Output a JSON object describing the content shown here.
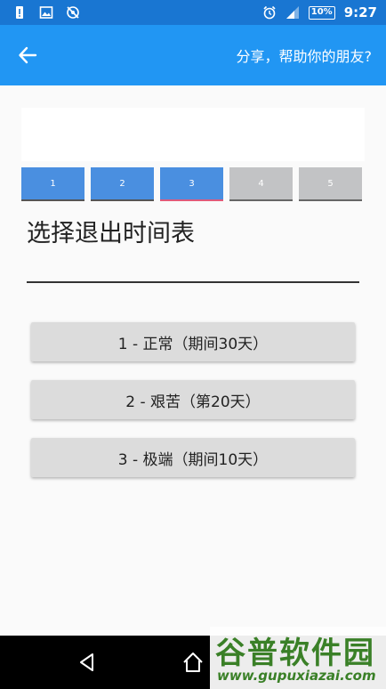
{
  "status_bar": {
    "time": "9:27",
    "battery": "10%",
    "left_icons": [
      "battery-alert-icon",
      "image-icon",
      "sync-disabled-icon"
    ],
    "right_icons": [
      "alarm-icon",
      "signal-icon",
      "battery-icon"
    ]
  },
  "app_bar": {
    "back_icon": "arrow-left-icon",
    "share_label": "分享，帮助你的朋友?"
  },
  "steps": [
    {
      "label": "1",
      "state": "done"
    },
    {
      "label": "2",
      "state": "done"
    },
    {
      "label": "3",
      "state": "current"
    },
    {
      "label": "4",
      "state": "todo"
    },
    {
      "label": "5",
      "state": "todo"
    }
  ],
  "page_title": "选择退出时间表",
  "options": [
    {
      "label": "1 - 正常（期间30天）"
    },
    {
      "label": "2 - 艰苦（第20天）"
    },
    {
      "label": "3 - 极端（期间10天）"
    }
  ],
  "nav_bar": {
    "icons": [
      "back-triangle-icon",
      "home-icon"
    ]
  },
  "watermark": {
    "title": "谷普软件园",
    "url": "www.gupuxiazai.com"
  },
  "colors": {
    "status_bar": "#1976d2",
    "app_bar": "#2196f3",
    "step_done": "#4a8fe0",
    "step_todo": "#c2c3c5",
    "step_current_underline": "#e05a7a",
    "option_bg": "#dcdcdc",
    "watermark": "#3f8a2a"
  }
}
